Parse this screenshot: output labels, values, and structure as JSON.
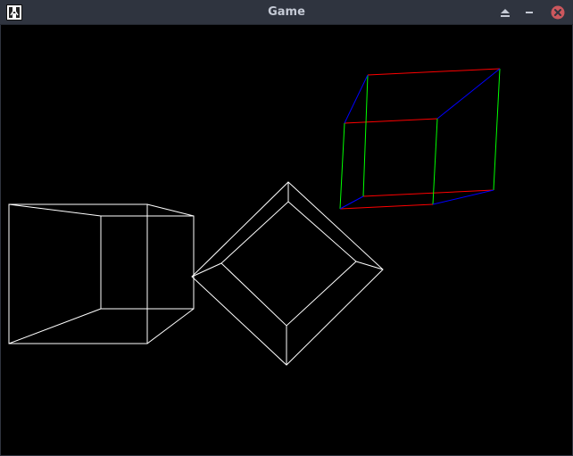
{
  "window": {
    "title": "Game",
    "controls": [
      "shade",
      "minimize",
      "close"
    ],
    "colors": {
      "titlebar": "#2f343f",
      "title_text": "#c5cad5",
      "close_button": "#cc575d",
      "viewport_background": "#000000"
    }
  },
  "scene": {
    "objects": [
      {
        "name": "white-wireframe-cube-left",
        "color": "#ffffff"
      },
      {
        "name": "white-wireframe-cube-center",
        "color": "#ffffff"
      },
      {
        "name": "colored-wireframe-cube-right",
        "edge_colors": {
          "x_axis": "#ff0000",
          "y_axis": "#00ff00",
          "z_axis": "#0000ff"
        }
      }
    ]
  }
}
